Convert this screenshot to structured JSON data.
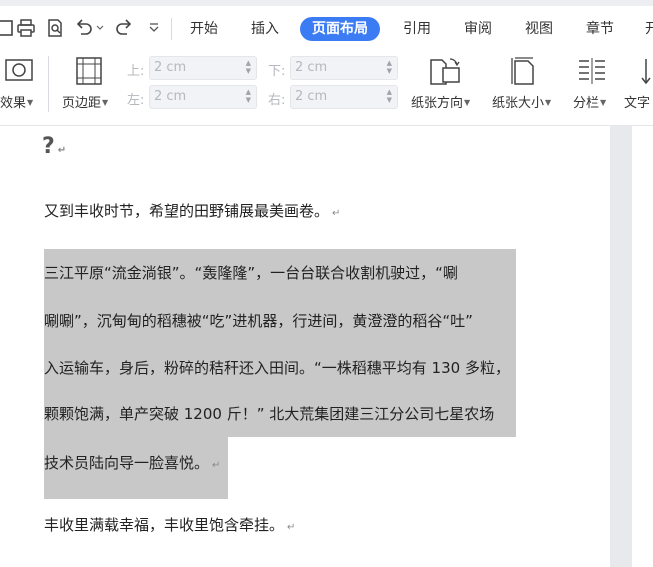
{
  "tabs": {
    "items": [
      {
        "label": "开始"
      },
      {
        "label": "插入"
      },
      {
        "label": "页面布局"
      },
      {
        "label": "引用"
      },
      {
        "label": "审阅"
      },
      {
        "label": "视图"
      },
      {
        "label": "章节"
      }
    ],
    "overflow": "开"
  },
  "quick_access": {
    "icons": [
      "print-icon",
      "print-preview-icon",
      "undo-icon",
      "redo-icon",
      "more-icon"
    ]
  },
  "ribbon": {
    "effects_label": "效果",
    "margins_label": "页边距",
    "orientation_label": "纸张方向",
    "size_label": "纸张大小",
    "columns_label": "分栏",
    "text_label": "文字",
    "margin_top_label": "上:",
    "margin_bottom_label": "下:",
    "margin_left_label": "左:",
    "margin_right_label": "右:",
    "margin_top_value": "2 cm",
    "margin_bottom_value": "2 cm",
    "margin_left_value": "2 cm",
    "margin_right_value": "2 cm"
  },
  "document": {
    "heading": "?",
    "para1": "又到丰收时节，希望的田野铺展最美画卷。",
    "sel_lines": [
      "三江平原“流金淌银”。“轰隆隆”，一台台联合收割机驶过，“唰",
      "唰唰”，沉甸甸的稻穗被“吃”进机器，行进间，黄澄澄的稻谷“吐”",
      "入运输车，身后，粉碎的秸秆还入田间。“一株稻穗平均有 130 多粒，",
      "颗颗饱满，单产突破 1200 斤！” 北大荒集团建三江分公司七星农场",
      "技术员陆向导一脸喜悦。"
    ],
    "para3": "丰收里满载幸福，丰收里饱含牵挂。"
  }
}
